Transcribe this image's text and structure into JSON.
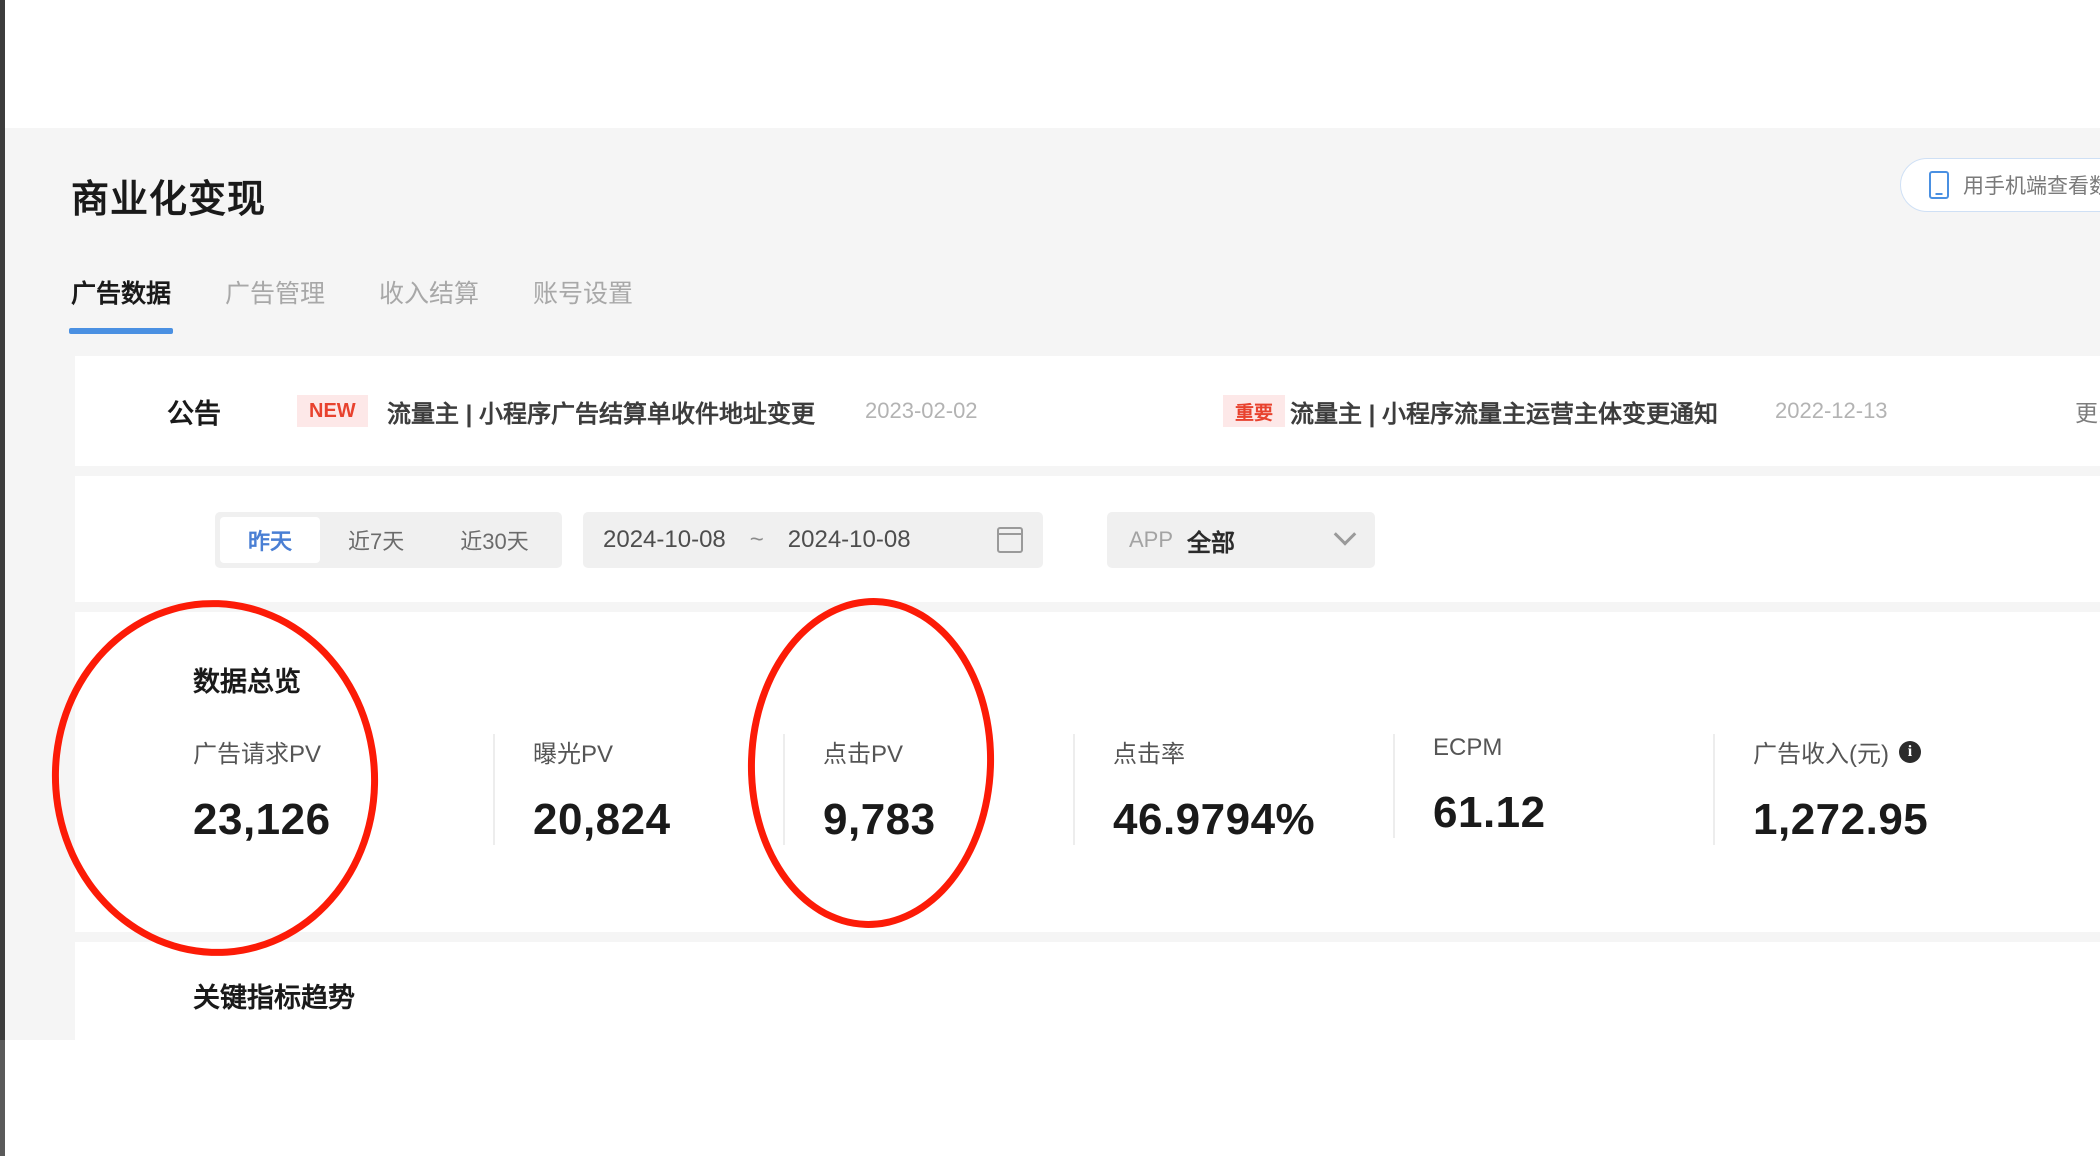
{
  "header": {
    "title": "商业化变现",
    "phone_button": {
      "label": "用手机端查看数",
      "icon": "phone-icon"
    }
  },
  "tabs": [
    {
      "label": "广告数据",
      "active": true
    },
    {
      "label": "广告管理",
      "active": false
    },
    {
      "label": "收入结算",
      "active": false
    },
    {
      "label": "账号设置",
      "active": false
    }
  ],
  "announcement": {
    "label": "公告",
    "more": "更多",
    "items": [
      {
        "badge": "NEW",
        "text": "流量主 | 小程序广告结算单收件地址变更",
        "date": "2023-02-02"
      },
      {
        "badge": "重要",
        "text": "流量主 | 小程序流量主运营主体变更通知",
        "date": "2022-12-13"
      }
    ]
  },
  "filters": {
    "segments": [
      {
        "label": "昨天",
        "active": true
      },
      {
        "label": "近7天",
        "active": false
      },
      {
        "label": "近30天",
        "active": false
      }
    ],
    "date_range": {
      "start": "2024-10-08",
      "separator": "~",
      "end": "2024-10-08",
      "icon": "calendar-icon"
    },
    "app_select": {
      "label": "APP",
      "value": "全部",
      "icon": "chevron-down-icon"
    }
  },
  "overview": {
    "title": "数据总览",
    "metrics": [
      {
        "label": "广告请求PV",
        "value": "23,126",
        "info": false
      },
      {
        "label": "曝光PV",
        "value": "20,824",
        "info": false
      },
      {
        "label": "点击PV",
        "value": "9,783",
        "info": false
      },
      {
        "label": "点击率",
        "value": "46.9794%",
        "info": false
      },
      {
        "label": "ECPM",
        "value": "61.12",
        "info": false
      },
      {
        "label": "广告收入(元)",
        "value": "1,272.95",
        "info": true
      }
    ]
  },
  "trend": {
    "title": "关键指标趋势"
  },
  "annotations": {
    "color": "#fc1b07",
    "shapes": [
      {
        "name": "circle-ad-request-pv",
        "target": "广告请求PV 23,126"
      },
      {
        "name": "circle-click-pv",
        "target": "点击PV 9,783"
      }
    ]
  }
}
